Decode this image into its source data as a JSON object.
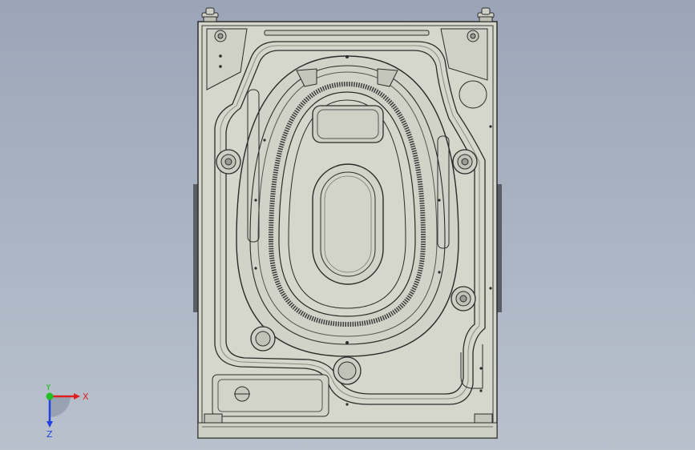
{
  "viewport": {
    "background_top": "#9aa6b8",
    "background_bottom": "#b9c1cd",
    "part_fill": "#d6d7cc",
    "part_edge": "#2b2b2b"
  },
  "triad": {
    "x_label": "X",
    "y_label": "Y",
    "z_label": "Z",
    "x_color": "#e02020",
    "y_color": "#20c020",
    "z_color": "#2040e0"
  }
}
